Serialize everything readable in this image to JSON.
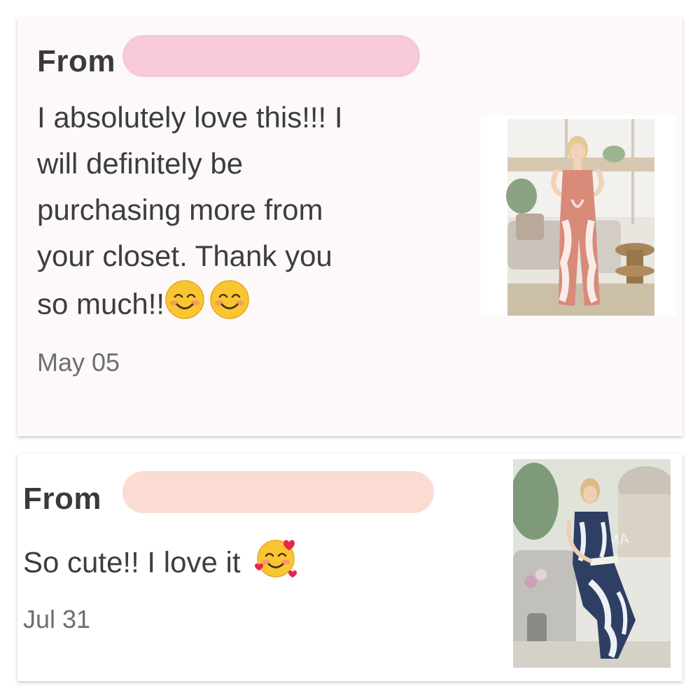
{
  "reviews": [
    {
      "from_label": "From",
      "message_lines": [
        "I absolutely love this!!! I",
        "will definitely be",
        "purchasing more from",
        "your closet. Thank you",
        "so much!!"
      ],
      "emojis": [
        "smiling-face-icon",
        "smiling-face-icon"
      ],
      "date": "May 05",
      "redaction_color": "#f7c9d9",
      "product_image": "pink-tie-dye-jumpsuit"
    },
    {
      "from_label": "From",
      "message": "So cute!! I love it",
      "emojis": [
        "smiling-face-with-hearts-icon"
      ],
      "date": "Jul 31",
      "redaction_color": "#fbdcd2",
      "product_image": "navy-tie-dye-jumpsuit"
    }
  ]
}
